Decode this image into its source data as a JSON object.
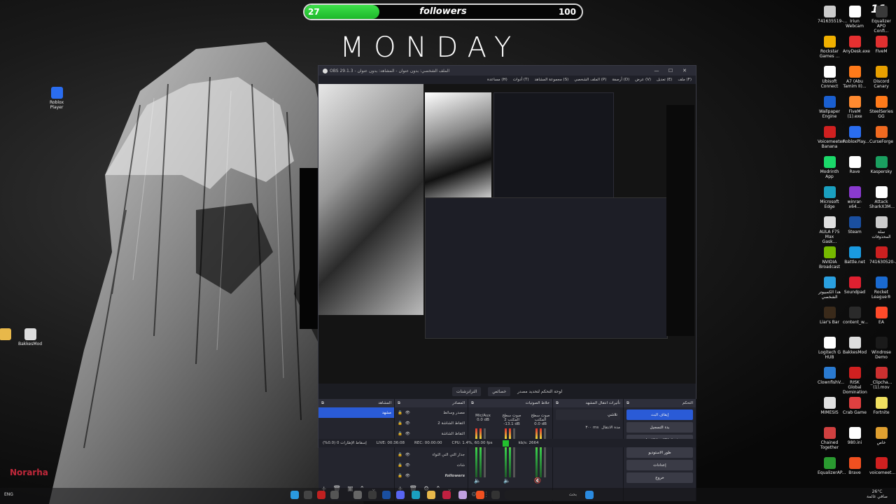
{
  "overlay": {
    "followers_current": "27",
    "followers_label": "followers",
    "followers_goal": "100",
    "progress_fraction": 0.27,
    "title": "MONDAY",
    "corner_badge": "11",
    "streamer_name": "Norarha"
  },
  "desktop_icons_left": [
    {
      "label": "Roblox Player",
      "color": "#2a6df0"
    },
    {
      "label": "BakkesMod",
      "color": "#dddddd"
    }
  ],
  "desktop_icons_right": [
    {
      "label": "741635519-...",
      "color": "#cccccc"
    },
    {
      "label": "Iriun Webcam",
      "color": "#ffffff"
    },
    {
      "label": "Equalizer APO Confi...",
      "color": "#3a3a3a"
    },
    {
      "label": "Rockstar Games ...",
      "color": "#f0b000"
    },
    {
      "label": "AnyDesk.exe",
      "color": "#e63030"
    },
    {
      "label": "FiveM",
      "color": "#e03030"
    },
    {
      "label": "Ubisoft Connect",
      "color": "#ffffff"
    },
    {
      "label": "A7 (Abu Tamim II)...",
      "color": "#ff7a1a"
    },
    {
      "label": "Discord Canary",
      "color": "#e8a000"
    },
    {
      "label": "Wallpaper Engine",
      "color": "#1a5fd0"
    },
    {
      "label": "FiveM (1).exe",
      "color": "#ff8a30"
    },
    {
      "label": "SteelSeries GG",
      "color": "#ff7a1a"
    },
    {
      "label": "Voicemeeter Banana",
      "color": "#d02020"
    },
    {
      "label": "RobloxPlay...",
      "color": "#2a6df0"
    },
    {
      "label": "CurseForge",
      "color": "#f06a20"
    },
    {
      "label": "Modrinth App",
      "color": "#1bd96a"
    },
    {
      "label": "Rave",
      "color": "#ffffff"
    },
    {
      "label": "Kaspersky",
      "color": "#1aa060"
    },
    {
      "label": "Microsoft Edge",
      "color": "#1aa0c0"
    },
    {
      "label": "winrar-x64...",
      "color": "#8a3ad0"
    },
    {
      "label": "Attack SharkX3M...",
      "color": "#ffffff"
    },
    {
      "label": "AULA F75 Max Gask...",
      "color": "#e0e0e0"
    },
    {
      "label": "Steam",
      "color": "#1a4fa0"
    },
    {
      "label": "سلة المحذوفات",
      "color": "#cccccc"
    },
    {
      "label": "NVIDIA Broadcast",
      "color": "#76b900"
    },
    {
      "label": "Battle.net",
      "color": "#1a9ae0"
    },
    {
      "label": "741630520-...",
      "color": "#cc2020"
    },
    {
      "label": "هذا الكمبيوتر الشخصي",
      "color": "#2aa0e0"
    },
    {
      "label": "Soundpad",
      "color": "#e02030"
    },
    {
      "label": "Rocket League®",
      "color": "#1a6ad0"
    },
    {
      "label": "Liar's Bar",
      "color": "#3a2a1a"
    },
    {
      "label": "content_w...",
      "color": "#2a2a2a"
    },
    {
      "label": "EA",
      "color": "#ff4a2a"
    },
    {
      "label": "Logitech G HUB",
      "color": "#ffffff"
    },
    {
      "label": "BakkesMod",
      "color": "#dddddd"
    },
    {
      "label": "Windrose Demo",
      "color": "#1a1a1a"
    },
    {
      "label": "ClownfishV...",
      "color": "#2a7ad0"
    },
    {
      "label": "RISK Global Domination",
      "color": "#d02020"
    },
    {
      "label": "_Clipcha... (1).mov",
      "color": "#cc3030"
    },
    {
      "label": "MIMESIS",
      "color": "#e0e0e0"
    },
    {
      "label": "Crab Game",
      "color": "#e04040"
    },
    {
      "label": "Fortnite",
      "color": "#f0e060"
    },
    {
      "label": "Chained Together",
      "color": "#d04040"
    },
    {
      "label": "980.ini",
      "color": "#ffffff"
    },
    {
      "label": "خاص",
      "color": "#e0a030"
    },
    {
      "label": "EqualizerAP...",
      "color": "#2a9a30"
    },
    {
      "label": "Brave",
      "color": "#f05020"
    },
    {
      "label": "voicemeet...",
      "color": "#d02020"
    }
  ],
  "obs": {
    "title": "OBS 29.1.3 - الملف الشخصي: بدون عنوان - المشاهد: بدون عنوان",
    "menu": [
      "ملف (F)",
      "تعديل (E)",
      "عرض (V)",
      "أرصفة (D)",
      "الملف الشخصي (P)",
      "مجموعة المشاهد (S)",
      "أدوات (T)",
      "مساعدة (H)"
    ],
    "mode_buttons": [
      "الترانزشنات",
      "خصائص",
      "لوحة التحكم لتحديد مصدر"
    ],
    "docks": {
      "scenes_title": "المشاهد",
      "scenes": [
        "مشهد"
      ],
      "sources_title": "المصادر",
      "sources": [
        "مصدر وسائط",
        "التقاط الشاشة 2",
        "التقاط الشاشة",
        "مراقب",
        "جدار التي التي التواء",
        "شات",
        "followers"
      ],
      "mixer_title": "خلاط الصوتيات",
      "mixer_channels": [
        {
          "name": "Mic/Aux",
          "level": "0.0 dB"
        },
        {
          "name": "صوت سطح المكتب 2",
          "level": "-13.1 dB"
        },
        {
          "name": "صوت سطح المكتب",
          "level": "0.0 dB"
        }
      ],
      "transitions_title": "تأثيرات انتقال المشهد",
      "transition_type": "تلاشي",
      "duration_label": "مدة الانتقال",
      "duration_value": "٣٠٠ ms",
      "controls_title": "التحكم",
      "controls": [
        "إيقاف البث",
        "بدء التسجيل",
        "تشغيل الكاميرا الافتراضية",
        "طور الاستوديو",
        "إعدادات",
        "خروج"
      ]
    },
    "status": {
      "dropped": "إسقاط الإطارات 0 (0.0%)",
      "live": "LIVE: 00:36:08",
      "rec": "REC: 00:00:00",
      "cpu": "CPU: 1.4%, 60.00 fps",
      "kbps": "kb/s: 2664"
    }
  },
  "taskbar": {
    "search_placeholder": "بحث",
    "lang": "ENG",
    "weather": "26°C",
    "weather_desc": "صافي غائمة",
    "time": "٦:٣٤"
  }
}
